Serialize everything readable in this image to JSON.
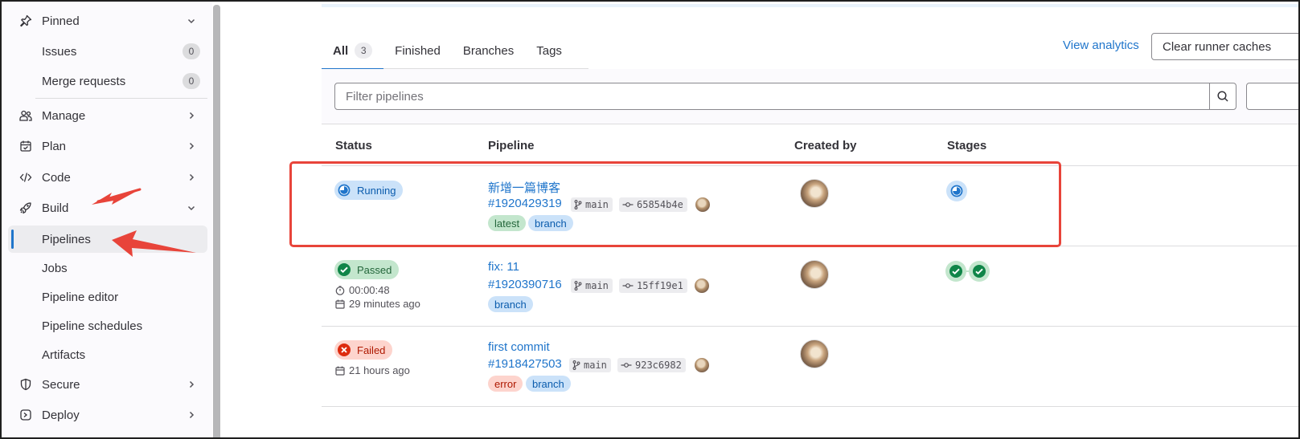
{
  "sidebar": {
    "pinned": {
      "label": "Pinned",
      "icon": "pin-icon"
    },
    "pinned_items": [
      {
        "label": "Issues",
        "count": "0"
      },
      {
        "label": "Merge requests",
        "count": "0"
      }
    ],
    "sections": [
      {
        "label": "Manage",
        "icon": "users-icon"
      },
      {
        "label": "Plan",
        "icon": "calendar-icon"
      },
      {
        "label": "Code",
        "icon": "code-icon"
      },
      {
        "label": "Build",
        "icon": "rocket-icon"
      }
    ],
    "build_items": [
      {
        "label": "Pipelines",
        "active": true
      },
      {
        "label": "Jobs"
      },
      {
        "label": "Pipeline editor"
      },
      {
        "label": "Pipeline schedules"
      },
      {
        "label": "Artifacts"
      }
    ],
    "more_sections": [
      {
        "label": "Secure",
        "icon": "shield-icon"
      },
      {
        "label": "Deploy",
        "icon": "deploy-icon"
      }
    ]
  },
  "tabs": [
    {
      "label": "All",
      "count": "3",
      "active": true
    },
    {
      "label": "Finished"
    },
    {
      "label": "Branches"
    },
    {
      "label": "Tags"
    }
  ],
  "actions": {
    "view_analytics": "View analytics",
    "clear_cache": "Clear runner caches"
  },
  "filter": {
    "placeholder": "Filter pipelines"
  },
  "table": {
    "headers": [
      "Status",
      "Pipeline",
      "Created by",
      "Stages"
    ],
    "rows": [
      {
        "status": "Running",
        "title": "新增一篇博客",
        "id": "#1920429319",
        "ref": "main",
        "commit": "65854b4e",
        "tags": [
          "latest",
          "branch"
        ],
        "stages": [
          "running"
        ]
      },
      {
        "status": "Passed",
        "duration": "00:00:48",
        "finished": "29 minutes ago",
        "title": "fix: 11",
        "id": "#1920390716",
        "ref": "main",
        "commit": "15ff19e1",
        "tags": [
          "branch"
        ],
        "stages": [
          "passed",
          "passed"
        ]
      },
      {
        "status": "Failed",
        "finished": "21 hours ago",
        "title": "first commit",
        "id": "#1918427503",
        "ref": "main",
        "commit": "923c6982",
        "tags": [
          "error",
          "branch"
        ],
        "stages": []
      }
    ]
  },
  "colors": {
    "link": "#1f75cb",
    "running": "#1f75cb",
    "passed": "#108548",
    "failed": "#dd2b0e",
    "annotation": "#e8443a"
  }
}
